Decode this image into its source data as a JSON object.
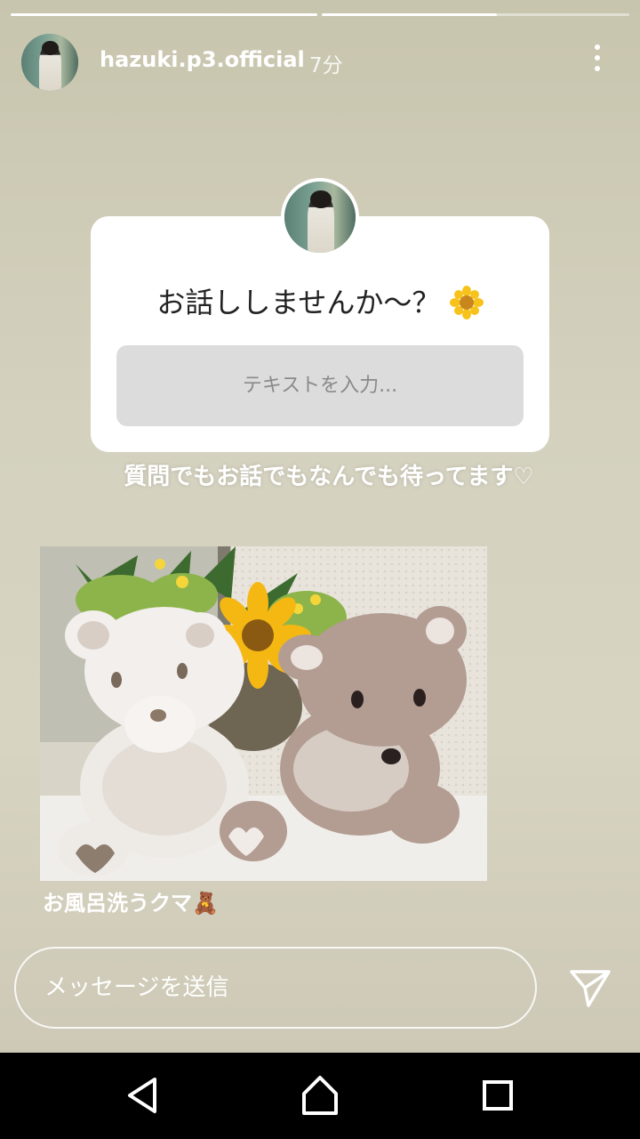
{
  "story": {
    "progress": [
      1.0,
      0.57
    ],
    "username": "hazuki.p3.official",
    "time": "7分"
  },
  "question_card": {
    "prompt": "お話ししませんか〜？",
    "prompt_emoji": "sunflower-icon",
    "input_placeholder": "テキストを入力..."
  },
  "caption_top": "質問でもお話でもなんでも待ってます♡",
  "caption_bottom": "お風呂洗うクマ🧸",
  "reply": {
    "placeholder": "メッセージを送信"
  },
  "navbar": {
    "icons": [
      "back-icon",
      "home-icon",
      "recents-icon"
    ]
  }
}
